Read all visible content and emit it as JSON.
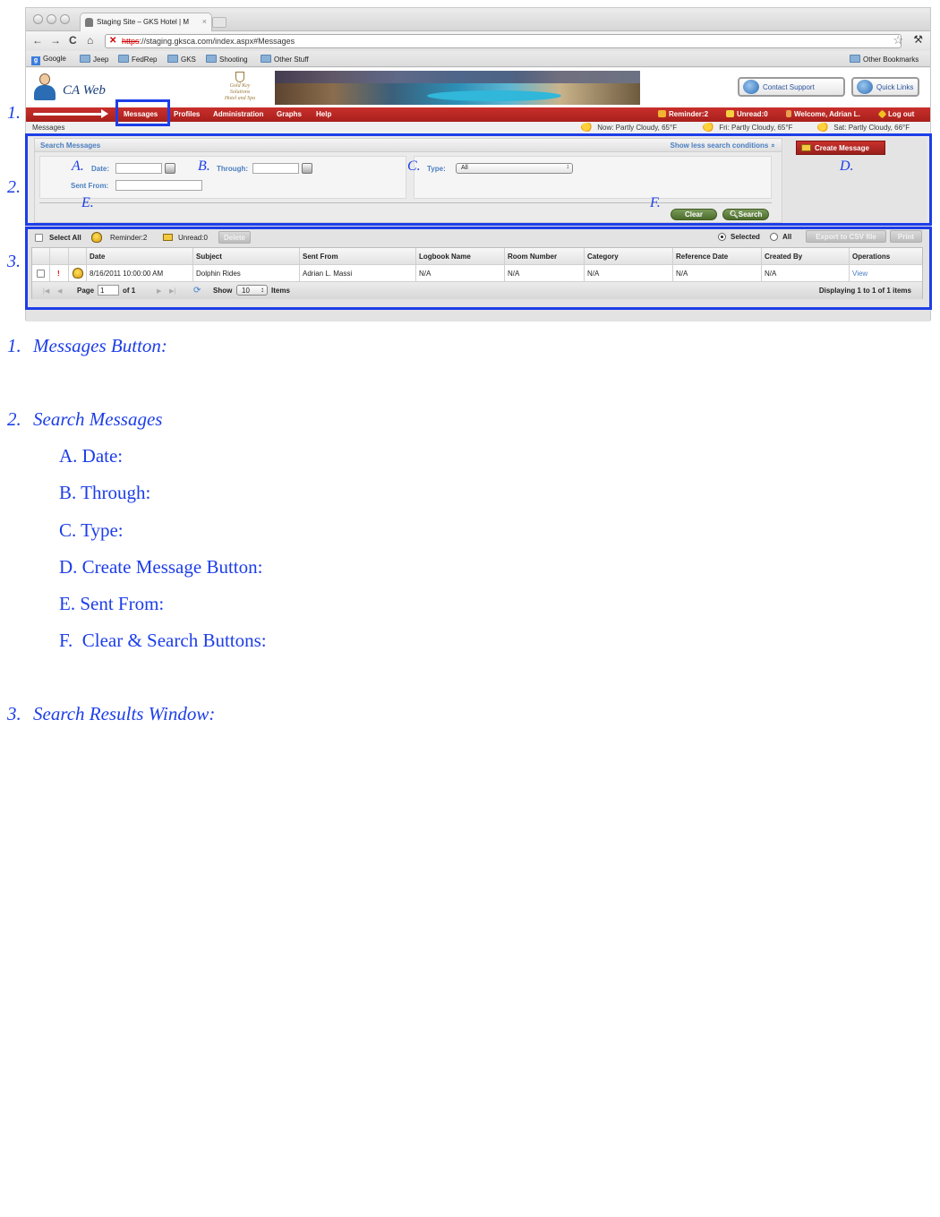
{
  "browser": {
    "tab_title": "Staging Site – GKS Hotel | M",
    "tab_close": "×",
    "url_protocol": "https",
    "url_rest": "://staging.gksca.com/index.aspx#Messages",
    "nav_back": "←",
    "nav_forward": "→",
    "nav_reload": "C",
    "nav_home": "⌂",
    "star": "☆",
    "wrench": "🔧",
    "bookmarks": [
      "Google",
      "Jeep",
      "FedRep",
      "GKS",
      "Shooting",
      "Other Stuff"
    ],
    "other_bookmarks": "Other Bookmarks"
  },
  "app": {
    "brand": "CA Web",
    "hotel_logo_lines": [
      "Gold Key",
      "Solutions",
      "Hotel and Spa"
    ],
    "contact_support": "Contact Support",
    "quick_links": "Quick Links",
    "menu": [
      "Messages",
      "Profiles",
      "Administration",
      "Graphs",
      "Help"
    ],
    "menu_right": {
      "reminder": "Reminder:2",
      "unread": "Unread:0",
      "welcome": "Welcome, Adrian L.",
      "logout": "Log out"
    },
    "breadcrumb": "Messages",
    "weather": [
      "Now: Partly Cloudy, 65°F",
      "Fri: Partly Cloudy, 65°F",
      "Sat: Partly Cloudy, 66°F"
    ],
    "search": {
      "title": "Search Messages",
      "show_less": "Show less search conditions",
      "show_less_icon": "»",
      "date_label": "Date:",
      "through_label": "Through:",
      "sent_from_label": "Sent From:",
      "type_label": "Type:",
      "type_value": "All",
      "clear": "Clear",
      "search": "Search"
    },
    "create_message": "Create Message",
    "results": {
      "select_all": "Select All",
      "reminder": "Reminder:2",
      "unread": "Unread:0",
      "delete": "Delete",
      "selected": "Selected",
      "all": "All",
      "export": "Export to CSV file",
      "print": "Print",
      "columns": [
        "Date",
        "Subject",
        "Sent From",
        "Logbook Name",
        "Room Number",
        "Category",
        "Reference Date",
        "Created By",
        "Operations"
      ],
      "rows": [
        {
          "flag": "!",
          "date": "8/16/2011 10:00:00 AM",
          "subject": "Dolphin Rides",
          "sent_from": "Adrian L. Massi",
          "logbook": "N/A",
          "room": "N/A",
          "category": "N/A",
          "reference_date": "N/A",
          "created_by": "N/A",
          "operation": "View"
        }
      ],
      "pager": {
        "page_label": "Page",
        "page_value": "1",
        "of": "of 1",
        "show": "Show",
        "show_value": "10",
        "items": "Items",
        "displaying": "Displaying 1 to 1 of 1 items"
      }
    }
  },
  "annotations": {
    "n1": "1.",
    "n2": "2.",
    "n3": "3.",
    "a": "A.",
    "b": "B.",
    "c": "C.",
    "d": "D.",
    "e": "E.",
    "f": "F."
  },
  "legend": {
    "items": [
      {
        "num": "1.",
        "text": "Messages Button:"
      },
      {
        "num": "2.",
        "text": "Search Messages"
      },
      {
        "num": "3.",
        "text": "Search Results Window:"
      }
    ],
    "sub_items": [
      "A. Date:",
      "B. Through:",
      "C. Type:",
      "D. Create Message Button:",
      "E. Sent From:",
      "F.  Clear & Search Buttons:"
    ]
  },
  "colors": {
    "annotation": "#1d3ee8",
    "menu_red": "#b8241f",
    "link_blue": "#4a7fc0"
  }
}
